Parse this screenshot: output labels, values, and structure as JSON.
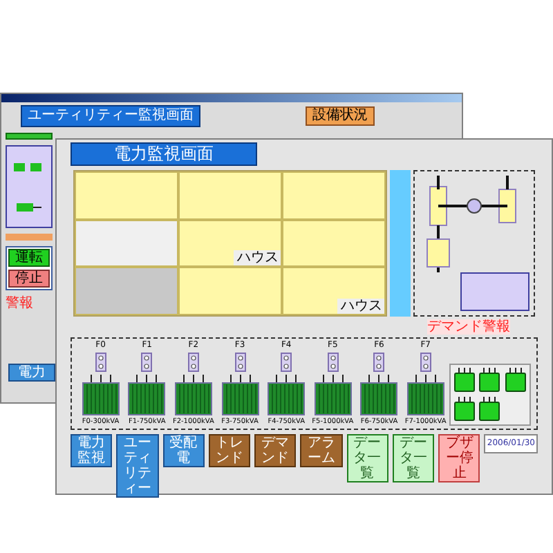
{
  "back_window": {
    "header": "ユーティリティー監視画面",
    "status_button": "設備状況",
    "left_buttons": [
      {
        "label": "運転",
        "kind": "run"
      },
      {
        "label": "停止",
        "kind": "stop"
      }
    ],
    "alarm_text": "警報",
    "nav_button": "電力"
  },
  "front_window": {
    "header": "電力監視画面",
    "rooms": [
      "ハウス",
      "ハウス"
    ],
    "demand_alarm": "デマンド警報",
    "transformers": [
      {
        "bus": "F0",
        "label": "F0-300kVA",
        "on": true
      },
      {
        "bus": "F1",
        "label": "F1-750kVA",
        "on": true
      },
      {
        "bus": "F2",
        "label": "F2-1000kVA",
        "on": true
      },
      {
        "bus": "F3",
        "label": "F3-750kVA",
        "on": true
      },
      {
        "bus": "F4",
        "label": "F4-750kVA",
        "on": true
      },
      {
        "bus": "F5",
        "label": "F5-1000kVA",
        "on": true
      },
      {
        "bus": "F6",
        "label": "F6-750kVA",
        "on": true
      },
      {
        "bus": "F7",
        "label": "F7-1000kVA",
        "on": true
      }
    ],
    "units": [
      {
        "on": true
      },
      {
        "on": true
      },
      {
        "on": true
      },
      {
        "on": true
      },
      {
        "on": true
      }
    ],
    "buttons": [
      {
        "label": "電力監視",
        "kind": "nav"
      },
      {
        "label": "ユーティリティー",
        "kind": "nav"
      },
      {
        "label": "受配電",
        "kind": "nav"
      },
      {
        "label": "トレンド",
        "kind": "trend"
      },
      {
        "label": "デマンド",
        "kind": "trend"
      },
      {
        "label": "アラーム",
        "kind": "trend"
      },
      {
        "label": "データ一覧",
        "kind": "data"
      },
      {
        "label": "データ一覧",
        "kind": "data"
      },
      {
        "label": "ブザー停止",
        "kind": "alarm"
      }
    ],
    "date": "2006/01/30"
  }
}
